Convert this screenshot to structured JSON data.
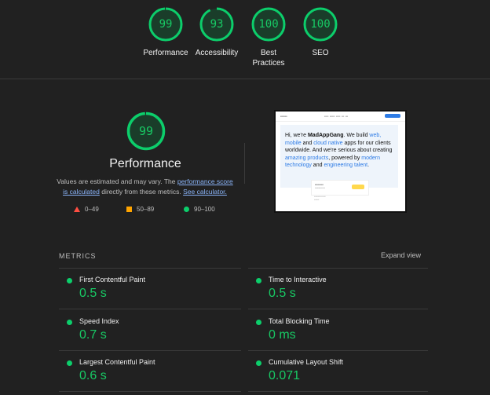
{
  "top_gauges": [
    {
      "score": "99",
      "label": "Performance",
      "fraction": 0.99
    },
    {
      "score": "93",
      "label": "Accessibility",
      "fraction": 0.93
    },
    {
      "score": "100",
      "label_line1": "Best",
      "label_line2": "Practices",
      "fraction": 1.0
    },
    {
      "score": "100",
      "label": "SEO",
      "fraction": 1.0
    }
  ],
  "performance": {
    "score": "99",
    "fraction": 0.99,
    "title": "Performance",
    "desc_part1": "Values are estimated and may vary. The ",
    "desc_link1": "performance score is calculated",
    "desc_part2": " directly from these metrics. ",
    "desc_link2": "See calculator."
  },
  "legend": {
    "fail": "0–49",
    "average": "50–89",
    "pass": "90–100"
  },
  "screenshot": {
    "hero_l1_a": "Hi, we're ",
    "hero_brand": "MadAppGang",
    "hero_l1_b": ". We build ",
    "hero_web": "web,",
    "hero_mobile": "mobile",
    "hero_and1": " and ",
    "hero_cloud": "cloud native",
    "hero_l2": " apps for our clients worldwide. And we're serious about creating ",
    "hero_amazing": "amazing products",
    "hero_l3": ", powered by ",
    "hero_modern": "modern technology",
    "hero_and2": " and ",
    "hero_eng": "engineering talent",
    "hero_end": "."
  },
  "metrics": {
    "heading": "METRICS",
    "expand": "Expand view",
    "items": [
      {
        "name": "First Contentful Paint",
        "value": "0.5 s"
      },
      {
        "name": "Time to Interactive",
        "value": "0.5 s"
      },
      {
        "name": "Speed Index",
        "value": "0.7 s"
      },
      {
        "name": "Total Blocking Time",
        "value": "0 ms"
      },
      {
        "name": "Largest Contentful Paint",
        "value": "0.6 s"
      },
      {
        "name": "Cumulative Layout Shift",
        "value": "0.071"
      }
    ]
  },
  "colors": {
    "pass": "#0cce6b",
    "average": "#ffa400",
    "fail": "#ff4e42",
    "link": "#8ab4f8",
    "background": "#212121"
  }
}
